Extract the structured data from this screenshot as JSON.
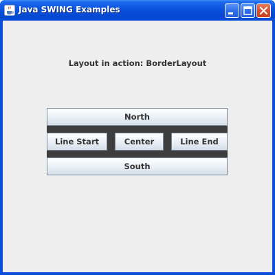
{
  "window": {
    "title": "Java SWING Examples",
    "title_bar_color": "#0a4fd8",
    "app_icon": "java-cup-icon",
    "controls": [
      "minimize-icon",
      "maximize-icon",
      "close-icon"
    ]
  },
  "content": {
    "heading": "Layout in action: BorderLayout",
    "background_color": "#eeeeee",
    "panel_background_color": "#3e3e3e",
    "buttons": {
      "north": "North",
      "line_start": "Line Start",
      "center": "Center",
      "line_end": "Line End",
      "south": "South"
    }
  }
}
